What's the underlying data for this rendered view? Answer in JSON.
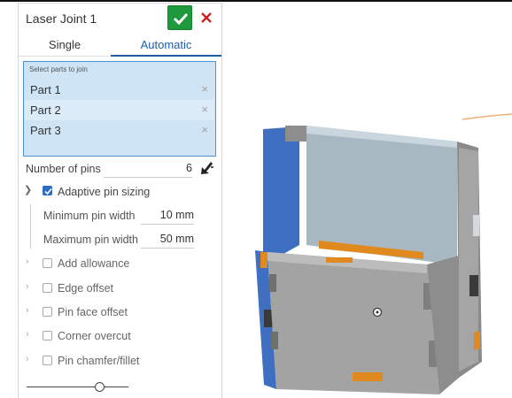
{
  "dialog": {
    "title": "Laser Joint 1",
    "confirm_icon": "checkmark-icon",
    "cancel_icon": "close-icon",
    "accent": "#1f5fa8",
    "confirm_color": "#1e9a3c",
    "cancel_color": "#cc2222"
  },
  "tabs": [
    {
      "label": "Single",
      "active": false
    },
    {
      "label": "Automatic",
      "active": true
    }
  ],
  "parts_selector": {
    "label": "Select parts to join",
    "items": [
      {
        "label": "Part 1"
      },
      {
        "label": "Part 2"
      },
      {
        "label": "Part 3"
      }
    ]
  },
  "pins": {
    "label": "Number of pins",
    "value": "6",
    "flip_icon": "arrow-icon"
  },
  "adaptive": {
    "label": "Adaptive pin sizing",
    "checked": true,
    "expanded": true,
    "min_label": "Minimum pin width",
    "min_value": "10 mm",
    "max_label": "Maximum pin width",
    "max_value": "50 mm"
  },
  "options": [
    {
      "label": "Add allowance",
      "checked": false
    },
    {
      "label": "Edge offset",
      "checked": false
    },
    {
      "label": "Pin face offset",
      "checked": false
    },
    {
      "label": "Corner overcut",
      "checked": false
    },
    {
      "label": "Pin chamfer/fillet",
      "checked": false
    }
  ],
  "slider": {
    "level": 0.75
  },
  "model": {
    "colors": {
      "face": "#9a9a9a",
      "blue": "#3f6fc0",
      "orange": "#e0891f",
      "inner": "#c8d2d9"
    }
  }
}
